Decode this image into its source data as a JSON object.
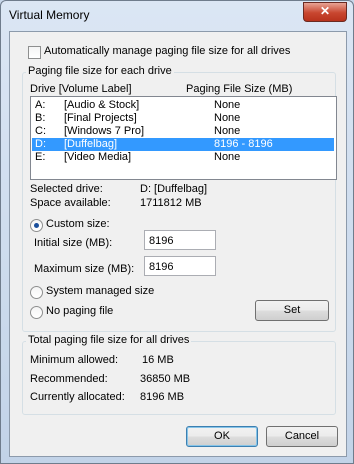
{
  "window": {
    "title": "Virtual Memory",
    "close_glyph": "✕"
  },
  "auto_manage": {
    "label": "Automatically manage paging file size for all drives",
    "checked": false
  },
  "per_drive": {
    "group_label": "Paging file size for each drive",
    "col_drive": "Drive  [Volume Label]",
    "col_size": "Paging File Size (MB)",
    "rows": [
      {
        "drive": "A:",
        "label": "[Audio & Stock]",
        "size": "None",
        "selected": false
      },
      {
        "drive": "B:",
        "label": "[Final Projects]",
        "size": "None",
        "selected": false
      },
      {
        "drive": "C:",
        "label": "[Windows 7 Pro]",
        "size": "None",
        "selected": false
      },
      {
        "drive": "D:",
        "label": "[Duffelbag]",
        "size": "8196 - 8196",
        "selected": true
      },
      {
        "drive": "E:",
        "label": "[Video Media]",
        "size": "None",
        "selected": false
      }
    ],
    "selected_drive_label": "Selected drive:",
    "selected_drive_value": "D:  [Duffelbag]",
    "space_label": "Space available:",
    "space_value": "1711812 MB",
    "custom_size_label": "Custom size:",
    "initial_label": "Initial size (MB):",
    "initial_value": "8196",
    "maximum_label": "Maximum size (MB):",
    "maximum_value": "8196",
    "system_managed_label": "System managed size",
    "no_paging_label": "No paging file",
    "set_button": "Set"
  },
  "totals": {
    "group_label": "Total paging file size for all drives",
    "min_label": "Minimum allowed:",
    "min_value": "16 MB",
    "rec_label": "Recommended:",
    "rec_value": "36850 MB",
    "cur_label": "Currently allocated:",
    "cur_value": "8196 MB"
  },
  "buttons": {
    "ok": "OK",
    "cancel": "Cancel"
  },
  "colors": {
    "selection": "#3399ff",
    "close_button": "#c8462f"
  }
}
